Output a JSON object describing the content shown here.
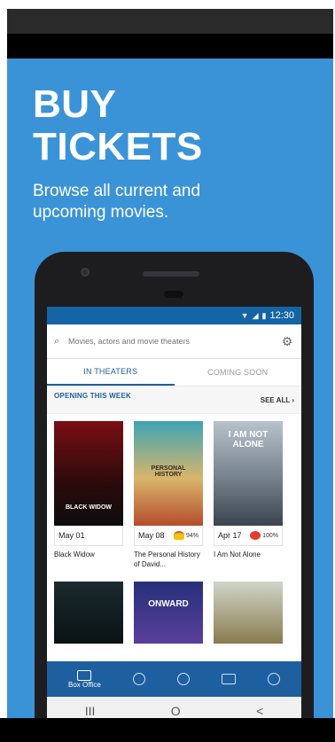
{
  "promo": {
    "headline_line1": "BUY",
    "headline_line2": "TICKETS",
    "subline_line1": "Browse all current and",
    "subline_line2": "upcoming movies."
  },
  "app": {
    "status_time": "12:30",
    "search_placeholder": "Movies, actors and movie theaters",
    "tabs": [
      "IN THEATERS",
      "COMING SOON"
    ],
    "section_title": "OPENING THIS WEEK",
    "see_all": "SEE ALL",
    "movies": [
      {
        "date": "May 01",
        "title": "Black Widow",
        "poster_text": "BLACK WIDOW",
        "score": ""
      },
      {
        "date": "May 08",
        "title": "The Personal History of David...",
        "poster_text": "PERSONAL HISTORY",
        "score": "94%"
      },
      {
        "date": "Apr 17",
        "title": "I Am Not Alone",
        "poster_text": "I AM NOT ALONE",
        "score": "100%"
      }
    ],
    "row2_posters": [
      "",
      "ONWARD",
      ""
    ],
    "nav": [
      {
        "label": "Box Office",
        "icon": "film-icon"
      },
      {
        "label": "",
        "icon": "ticket-icon"
      },
      {
        "label": "",
        "icon": "disc-icon"
      },
      {
        "label": "",
        "icon": "news-icon"
      },
      {
        "label": "",
        "icon": "profile-icon"
      }
    ],
    "android_nav": [
      "III",
      "O",
      "<"
    ]
  },
  "colors": {
    "promo_bg": "#3b93d7",
    "status_bg": "#1565a6",
    "accent": "#1e5fa0"
  }
}
